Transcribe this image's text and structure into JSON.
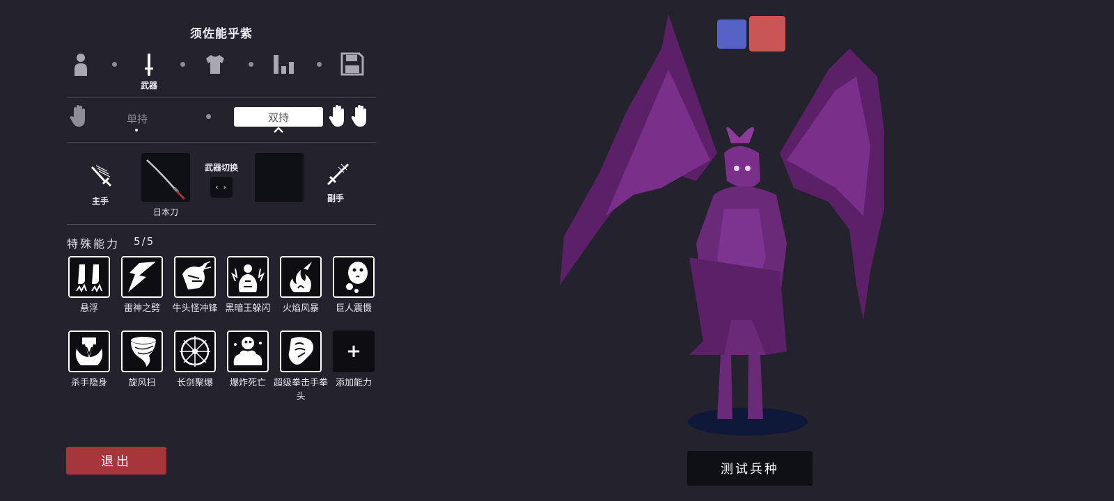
{
  "unit": {
    "name": "须佐能乎紫"
  },
  "steps": {
    "weapon_label": "武器"
  },
  "hold": {
    "single_label": "单持",
    "dual_label": "双持"
  },
  "weapons": {
    "main_hand_label": "主手",
    "main_weapon_name": "日本刀",
    "swap_label": "武器切换",
    "swap_button": "‹ ›",
    "off_hand_label": "副手"
  },
  "abilities": {
    "title": "特殊能力",
    "count": "5/5",
    "items": [
      {
        "label": "悬浮",
        "icon": "levitate-icon"
      },
      {
        "label": "雷神之劈",
        "icon": "lightning-icon"
      },
      {
        "label": "牛头怪冲锋",
        "icon": "minotaur-charge-icon"
      },
      {
        "label": "黑暗王躲闪",
        "icon": "dark-dodge-icon"
      },
      {
        "label": "火焰风暴",
        "icon": "fire-storm-icon"
      },
      {
        "label": "巨人震慑",
        "icon": "giant-roar-icon"
      },
      {
        "label": "杀手隐身",
        "icon": "assassin-stealth-icon"
      },
      {
        "label": "旋风扫",
        "icon": "whirlwind-icon"
      },
      {
        "label": "长剑聚爆",
        "icon": "sword-burst-icon"
      },
      {
        "label": "爆炸死亡",
        "icon": "explode-death-icon"
      },
      {
        "label": "超级拳击手拳头",
        "icon": "super-punch-icon"
      },
      {
        "label": "添加能力",
        "icon": "plus-icon"
      }
    ],
    "add_symbol": "+"
  },
  "buttons": {
    "exit": "退出",
    "test": "测试兵种"
  },
  "colors": {
    "background": "#23222d",
    "team_blue": "#5563c6",
    "team_red": "#c95556",
    "exit": "#a5353a",
    "figure": "#6a2a78"
  }
}
